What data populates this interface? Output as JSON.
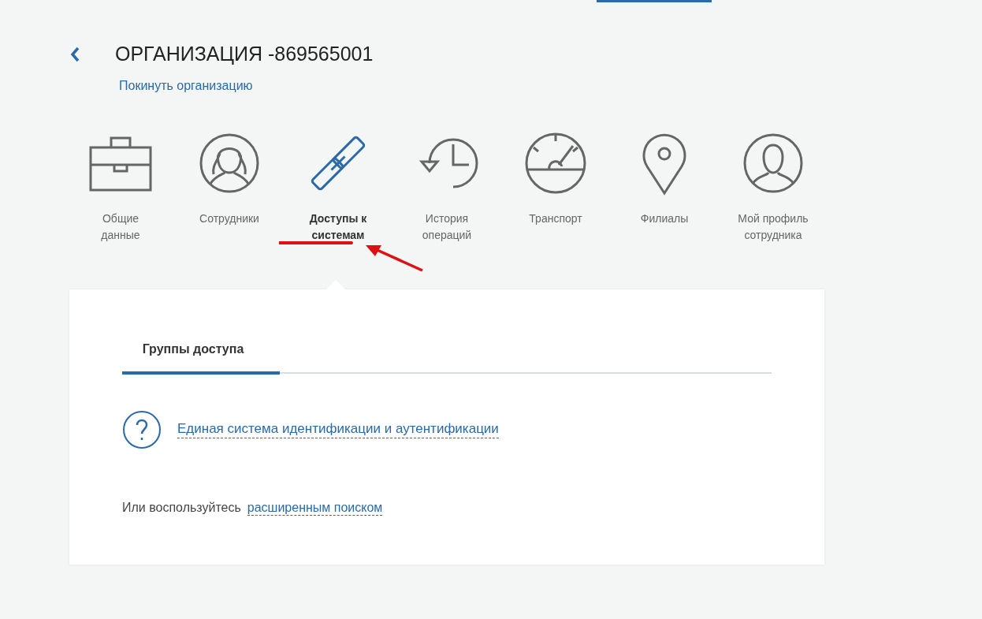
{
  "header": {
    "title": "ОРГАНИЗАЦИЯ -869565001",
    "leave_link": "Покинуть организацию"
  },
  "sections": [
    {
      "kind": "briefcase",
      "label": "Общие данные",
      "selected": false
    },
    {
      "kind": "group",
      "label": "Сотрудники",
      "selected": false
    },
    {
      "kind": "link",
      "label": "Доступы к системам",
      "selected": true
    },
    {
      "kind": "history",
      "label": "История операций",
      "selected": false
    },
    {
      "kind": "gauge",
      "label": "Транспорт",
      "selected": false
    },
    {
      "kind": "pin",
      "label": "Филиалы",
      "selected": false
    },
    {
      "kind": "person",
      "label": "Мой профиль сотрудника",
      "selected": false
    }
  ],
  "panel": {
    "tabs": [
      {
        "label": "Группы доступа",
        "selected": true
      }
    ],
    "systems": [
      {
        "label": "Единая система идентификации и аутентификации"
      }
    ],
    "search_hint": {
      "text": "Или воспользуйтесь",
      "link": "расширенным поиском"
    }
  }
}
